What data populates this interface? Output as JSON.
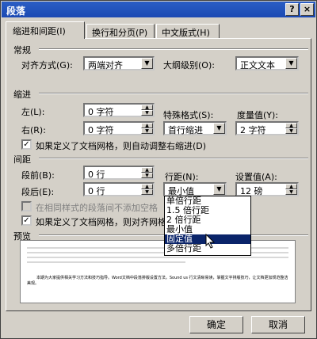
{
  "dialog": {
    "title": "段落",
    "help": "?",
    "close": "×"
  },
  "tabs": [
    {
      "label": "缩进和间距(I)"
    },
    {
      "label": "换行和分页(P)"
    },
    {
      "label": "中文版式(H)"
    }
  ],
  "general": {
    "heading": "常规",
    "alignment_label": "对齐方式(G):",
    "alignment_value": "两端对齐",
    "outline_label": "大纲级别(O):",
    "outline_value": "正文文本"
  },
  "indent": {
    "heading": "缩进",
    "left_label": "左(L):",
    "left_value": "0 字符",
    "right_label": "右(R):",
    "right_value": "0 字符",
    "special_label": "特殊格式(S):",
    "special_value": "首行缩进",
    "by_label": "度量值(Y):",
    "by_value": "2 字符",
    "autoadjust_label": "如果定义了文档网格，则自动调整右缩进(D)",
    "autoadjust_checked": "✓"
  },
  "spacing": {
    "heading": "间距",
    "before_label": "段前(B):",
    "before_value": "0 行",
    "after_label": "段后(E):",
    "after_value": "0 行",
    "line_label": "行距(N):",
    "line_value": "最小值",
    "at_label": "设置值(A):",
    "at_value": "12 磅",
    "nospace_label": "在相同样式的段落间不添加空格",
    "snap_label": "如果定义了文档网格，则对齐网格",
    "snap_checked": "✓"
  },
  "line_spacing_options": [
    "单倍行距",
    "1.5 倍行距",
    "2 倍行距",
    "最小值",
    "固定值",
    "多倍行距"
  ],
  "preview": {
    "heading": "预览",
    "sample_text": "本期为大家提供相关学习方法和技巧指导。Word文档中段落排版设置方法。Sound us 行文清晰易读，掌握文字排版技巧，让文档更加规范整洁美观。"
  },
  "buttons": {
    "ok": "确定",
    "cancel": "取消"
  }
}
